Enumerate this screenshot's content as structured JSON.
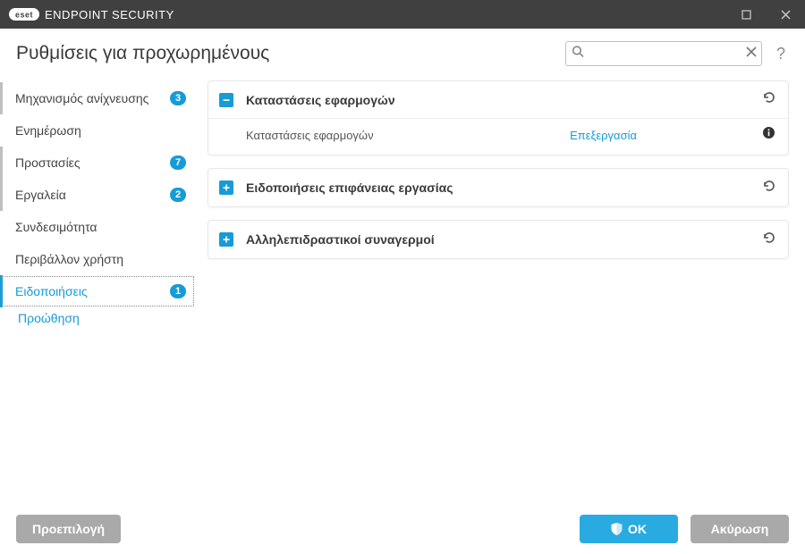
{
  "titlebar": {
    "brand": "ENDPOINT SECURITY",
    "logo_text": "eset"
  },
  "page_title": "Ρυθμίσεις για προχωρημένους",
  "search": {
    "value": "",
    "placeholder": ""
  },
  "help_glyph": "?",
  "sidebar": {
    "items": [
      {
        "label": "Μηχανισμός ανίχνευσης",
        "badge": "3",
        "active": false,
        "bar": true
      },
      {
        "label": "Ενημέρωση",
        "badge": null,
        "active": false
      },
      {
        "label": "Προστασίες",
        "badge": "7",
        "active": false,
        "bar": true
      },
      {
        "label": "Εργαλεία",
        "badge": "2",
        "active": false,
        "bar": true
      },
      {
        "label": "Συνδεσιμότητα",
        "badge": null,
        "active": false
      },
      {
        "label": "Περιβάλλον χρήστη",
        "badge": null,
        "active": false
      },
      {
        "label": "Ειδοποιήσεις",
        "badge": "1",
        "active": true
      }
    ],
    "sub": "Προώθηση"
  },
  "panels": [
    {
      "title": "Καταστάσεις εφαρμογών",
      "expanded": true,
      "row_label": "Καταστάσεις εφαρμογών",
      "row_link": "Επεξεργασία"
    },
    {
      "title": "Ειδοποιήσεις επιφάνειας εργασίας",
      "expanded": false
    },
    {
      "title": "Αλληλεπιδραστικοί συναγερμοί",
      "expanded": false
    }
  ],
  "footer": {
    "default_btn": "Προεπιλογή",
    "ok_btn": "OK",
    "cancel_btn": "Ακύρωση"
  }
}
